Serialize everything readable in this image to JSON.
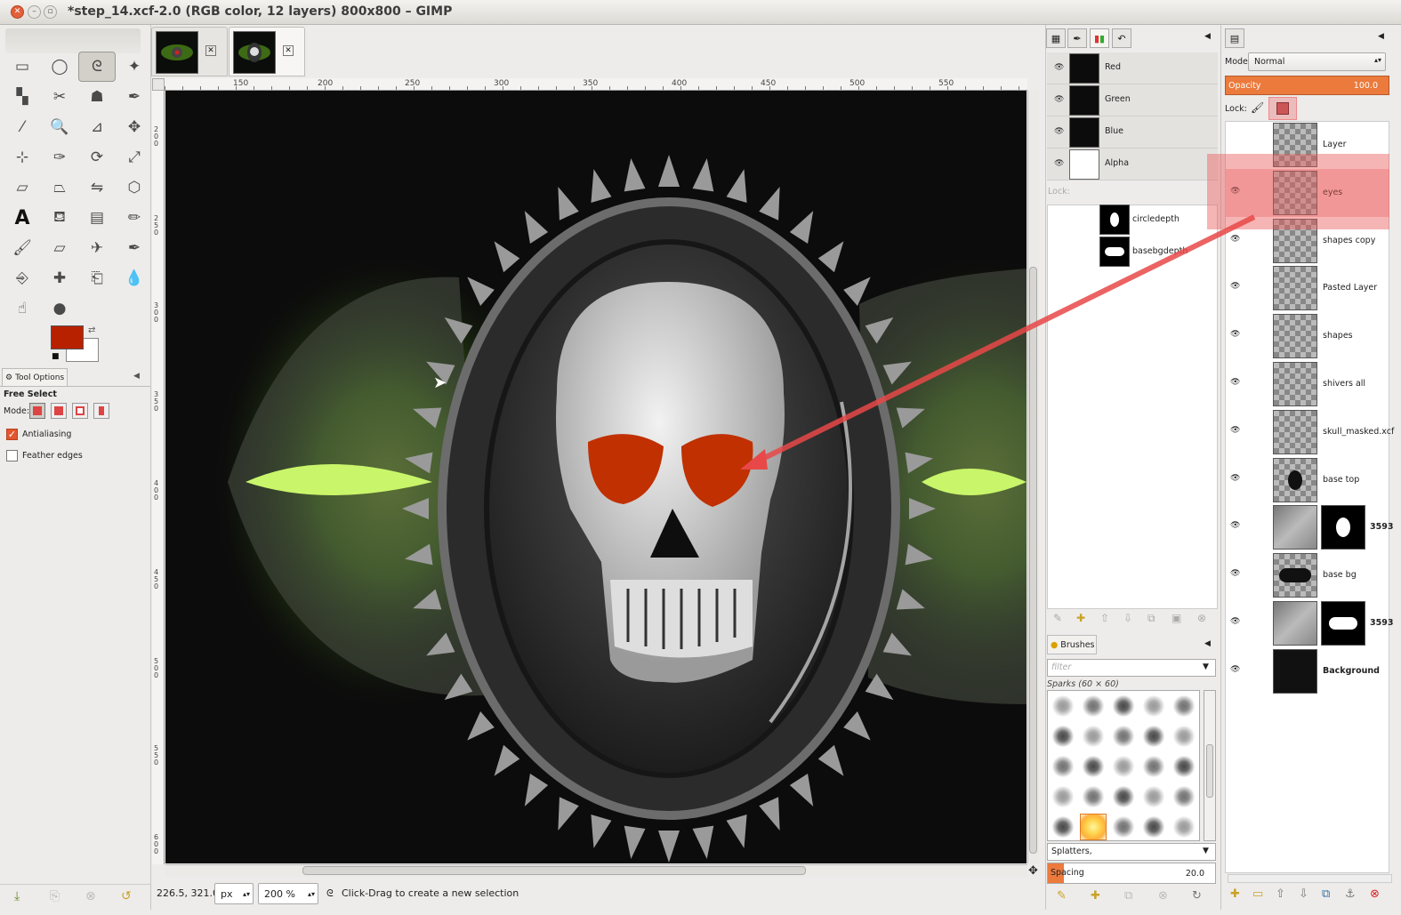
{
  "window": {
    "title": "*step_14.xcf-2.0 (RGB color, 12 layers) 800x800 – GIMP"
  },
  "toolbox": {
    "tools": [
      "rect-select-icon",
      "ellipse-select-icon",
      "free-select-icon",
      "fuzzy-select-icon",
      "select-by-color-icon",
      "scissors-icon",
      "foreground-select-icon",
      "paths-icon",
      "color-picker-icon",
      "zoom-icon",
      "measure-icon",
      "move-icon",
      "align-icon",
      "crop-icon",
      "rotate-icon",
      "scale-icon",
      "shear-icon",
      "perspective-icon",
      "flip-icon",
      "cage-icon",
      "text-icon",
      "bucket-fill-icon",
      "blend-icon",
      "pencil-icon",
      "paintbrush-icon",
      "eraser-icon",
      "airbrush-icon",
      "ink-icon",
      "clone-icon",
      "heal-icon",
      "perspective-clone-icon",
      "blur-icon",
      "smudge-icon",
      "dodge-burn-icon"
    ],
    "active_tool": "free-select-icon",
    "fg_color": "#b82100",
    "bg_color": "#ffffff"
  },
  "tool_options": {
    "tab_label": "Tool Options",
    "title": "Free Select",
    "mode_label": "Mode:",
    "antialiasing_label": "Antialiasing",
    "antialiasing_checked": true,
    "feather_label": "Feather edges",
    "feather_checked": false
  },
  "ruler": {
    "h_ticks": [
      "150",
      "200",
      "250",
      "300",
      "350",
      "400",
      "450",
      "500",
      "550"
    ],
    "v_ticks": [
      "200",
      "250",
      "300",
      "350",
      "400",
      "450",
      "500",
      "550",
      "600"
    ]
  },
  "status": {
    "coords": "226.5, 321.0",
    "unit": "px",
    "zoom": "200 %",
    "hint": "Click-Drag to create a new selection"
  },
  "channels": {
    "items": [
      {
        "label": "Red"
      },
      {
        "label": "Green"
      },
      {
        "label": "Blue"
      },
      {
        "label": "Alpha"
      }
    ],
    "lock_label": "Lock:",
    "paths": [
      {
        "label": "circledepth"
      },
      {
        "label": "basebgdepth"
      }
    ]
  },
  "brushes": {
    "tab_label": "Brushes",
    "filter_placeholder": "filter",
    "selected_name": "Sparks (60 × 60)",
    "tags_value": "Splatters,",
    "spacing_label": "Spacing",
    "spacing_value": "20.0"
  },
  "layers": {
    "mode_label": "Mode:",
    "mode_value": "Normal",
    "opacity_label": "Opacity",
    "opacity_value": "100.0",
    "lock_label": "Lock:",
    "items": [
      {
        "label": "Layer",
        "visible": false,
        "mask": false,
        "active": false
      },
      {
        "label": "eyes",
        "visible": true,
        "mask": false,
        "active": true
      },
      {
        "label": "shapes copy",
        "visible": true,
        "mask": false,
        "active": false
      },
      {
        "label": "Pasted Layer",
        "visible": true,
        "mask": false,
        "active": false
      },
      {
        "label": "shapes",
        "visible": true,
        "mask": false,
        "active": false
      },
      {
        "label": "shivers all",
        "visible": true,
        "mask": false,
        "active": false
      },
      {
        "label": "skull_masked.xcf",
        "visible": true,
        "mask": false,
        "active": false
      },
      {
        "label": "base top",
        "visible": true,
        "mask": false,
        "active": false
      },
      {
        "label": "3593",
        "visible": true,
        "mask": true,
        "active": false
      },
      {
        "label": "base bg",
        "visible": true,
        "mask": false,
        "active": false
      },
      {
        "label": "3593",
        "visible": true,
        "mask": true,
        "active": false
      },
      {
        "label": "Background",
        "visible": true,
        "mask": false,
        "active": false
      }
    ]
  }
}
